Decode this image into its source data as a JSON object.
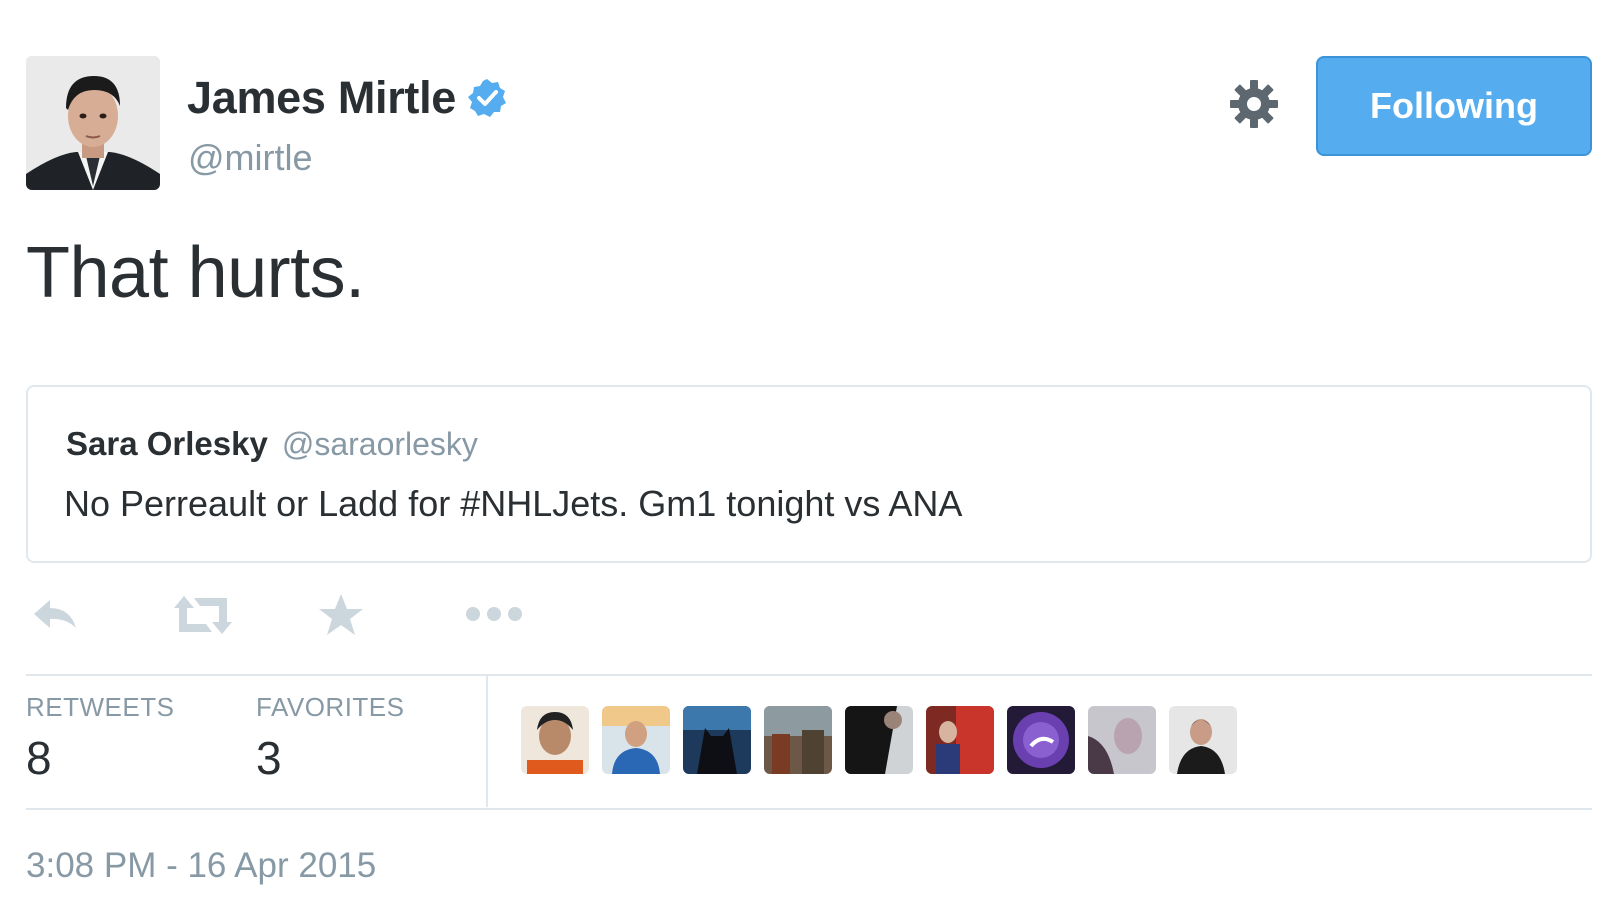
{
  "author": {
    "name": "James Mirtle",
    "handle": "@mirtle",
    "verified": true,
    "verified_icon": "verified-badge-icon"
  },
  "header": {
    "settings_icon": "gear-icon",
    "follow_label": "Following"
  },
  "tweet": {
    "text": "That hurts."
  },
  "quoted": {
    "name": "Sara Orlesky",
    "handle": "@saraorlesky",
    "text": "No Perreault or Ladd for #NHLJets. Gm1 tonight vs ANA"
  },
  "actions": [
    {
      "name": "reply",
      "icon": "reply-icon"
    },
    {
      "name": "retweet",
      "icon": "retweet-icon"
    },
    {
      "name": "favorite",
      "icon": "star-icon"
    },
    {
      "name": "more",
      "icon": "more-dots-icon"
    }
  ],
  "stats": {
    "retweets_label": "RETWEETS",
    "retweets_count": "8",
    "favorites_label": "FAVORITES",
    "favorites_count": "3"
  },
  "favoriters_count": 9,
  "timestamp": "3:08 PM - 16 Apr 2015",
  "colors": {
    "accent": "#55acee",
    "text": "#292f33",
    "muted": "#8899a6",
    "border": "#e1e8ed",
    "action_icon": "#ccd6dd"
  }
}
